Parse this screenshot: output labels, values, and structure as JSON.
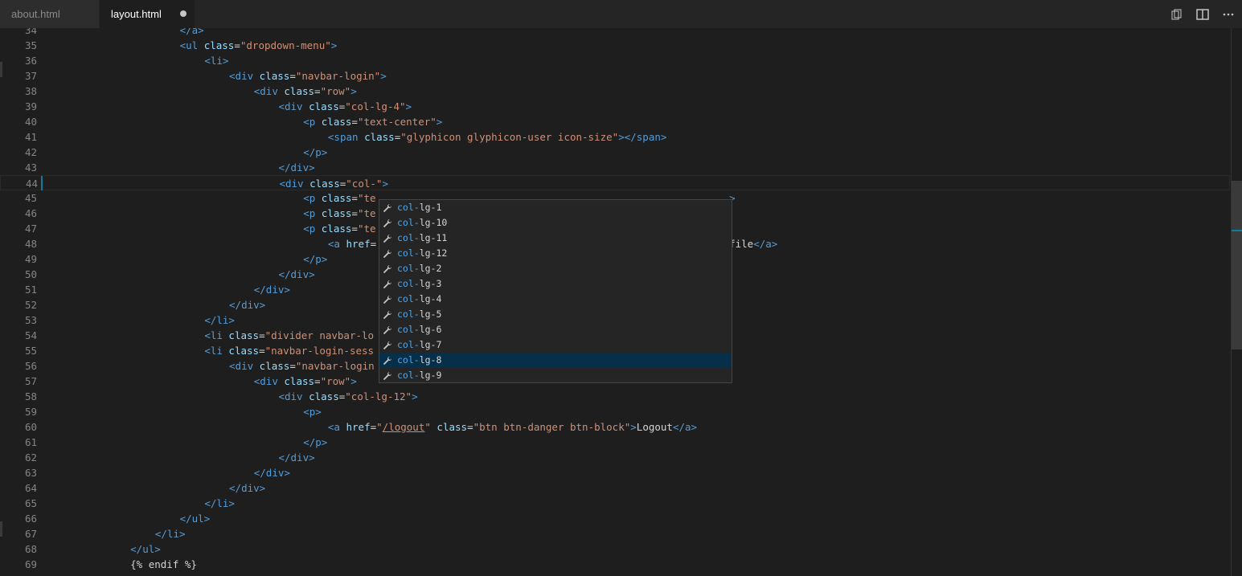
{
  "tabs": [
    {
      "label": "about.html",
      "active": false,
      "dirty": false
    },
    {
      "label": "layout.html",
      "active": true,
      "dirty": true
    }
  ],
  "actions": [
    {
      "icon": "copy-icon"
    },
    {
      "icon": "split-editor-icon"
    },
    {
      "icon": "more-icon"
    }
  ],
  "editor": {
    "current_line": 44,
    "lines": [
      {
        "n": "34",
        "i": 5,
        "segs": [
          [
            "</a>",
            "t"
          ]
        ]
      },
      {
        "n": "35",
        "i": 5,
        "segs": [
          [
            "<ul",
            "t"
          ],
          [
            " ",
            "x"
          ],
          [
            "class",
            "a"
          ],
          [
            "=",
            "x"
          ],
          [
            "\"dropdown-menu\"",
            "s"
          ],
          [
            ">",
            "t"
          ]
        ]
      },
      {
        "n": "36",
        "i": 6,
        "segs": [
          [
            "<li>",
            "t"
          ]
        ]
      },
      {
        "n": "37",
        "i": 7,
        "segs": [
          [
            "<div",
            "t"
          ],
          [
            " ",
            "x"
          ],
          [
            "class",
            "a"
          ],
          [
            "=",
            "x"
          ],
          [
            "\"navbar-login\"",
            "s"
          ],
          [
            ">",
            "t"
          ]
        ]
      },
      {
        "n": "38",
        "i": 8,
        "segs": [
          [
            "<div",
            "t"
          ],
          [
            " ",
            "x"
          ],
          [
            "class",
            "a"
          ],
          [
            "=",
            "x"
          ],
          [
            "\"row\"",
            "s"
          ],
          [
            ">",
            "t"
          ]
        ]
      },
      {
        "n": "39",
        "i": 9,
        "segs": [
          [
            "<div",
            "t"
          ],
          [
            " ",
            "x"
          ],
          [
            "class",
            "a"
          ],
          [
            "=",
            "x"
          ],
          [
            "\"col-lg-4\"",
            "s"
          ],
          [
            ">",
            "t"
          ]
        ]
      },
      {
        "n": "40",
        "i": 10,
        "segs": [
          [
            "<p",
            "t"
          ],
          [
            " ",
            "x"
          ],
          [
            "class",
            "a"
          ],
          [
            "=",
            "x"
          ],
          [
            "\"text-center\"",
            "s"
          ],
          [
            ">",
            "t"
          ]
        ]
      },
      {
        "n": "41",
        "i": 11,
        "segs": [
          [
            "<span",
            "t"
          ],
          [
            " ",
            "x"
          ],
          [
            "class",
            "a"
          ],
          [
            "=",
            "x"
          ],
          [
            "\"glyphicon glyphicon-user icon-size\"",
            "s"
          ],
          [
            "></span>",
            "t"
          ]
        ]
      },
      {
        "n": "42",
        "i": 10,
        "segs": [
          [
            "</p>",
            "t"
          ]
        ]
      },
      {
        "n": "43",
        "i": 9,
        "segs": [
          [
            "</div>",
            "t"
          ]
        ]
      },
      {
        "n": "44",
        "i": 9,
        "segs": [
          [
            "<div",
            "t"
          ],
          [
            " ",
            "x"
          ],
          [
            "class",
            "a"
          ],
          [
            "=",
            "x"
          ],
          [
            "\"col-\"",
            "s"
          ],
          [
            ">",
            "t"
          ]
        ]
      },
      {
        "n": "45",
        "i": 10,
        "segs": [
          [
            "<p",
            "t"
          ],
          [
            " ",
            "x"
          ],
          [
            "class",
            "a"
          ],
          [
            "=",
            "x"
          ],
          [
            "\"te",
            "s"
          ]
        ],
        "tail": {
          "col": 109,
          "segs": [
            [
              ">",
              "t"
            ]
          ]
        }
      },
      {
        "n": "46",
        "i": 10,
        "segs": [
          [
            "<p",
            "t"
          ],
          [
            " ",
            "x"
          ],
          [
            "class",
            "a"
          ],
          [
            "=",
            "x"
          ],
          [
            "\"te",
            "s"
          ]
        ]
      },
      {
        "n": "47",
        "i": 10,
        "segs": [
          [
            "<p",
            "t"
          ],
          [
            " ",
            "x"
          ],
          [
            "class",
            "a"
          ],
          [
            "=",
            "x"
          ],
          [
            "\"te",
            "s"
          ]
        ]
      },
      {
        "n": "48",
        "i": 11,
        "segs": [
          [
            "<a",
            "t"
          ],
          [
            " ",
            "x"
          ],
          [
            "href",
            "a"
          ],
          [
            "=",
            "x"
          ]
        ],
        "tail": {
          "col": 109,
          "segs": [
            [
              "file",
              "x"
            ],
            [
              "</a>",
              "t"
            ]
          ]
        }
      },
      {
        "n": "49",
        "i": 10,
        "segs": [
          [
            "</p>",
            "t"
          ]
        ]
      },
      {
        "n": "50",
        "i": 9,
        "segs": [
          [
            "</div>",
            "t"
          ]
        ]
      },
      {
        "n": "51",
        "i": 8,
        "segs": [
          [
            "</div>",
            "t"
          ]
        ]
      },
      {
        "n": "52",
        "i": 7,
        "segs": [
          [
            "</div>",
            "t"
          ]
        ]
      },
      {
        "n": "53",
        "i": 6,
        "segs": [
          [
            "</li>",
            "t"
          ]
        ]
      },
      {
        "n": "54",
        "i": 6,
        "segs": [
          [
            "<li",
            "t"
          ],
          [
            " ",
            "x"
          ],
          [
            "class",
            "a"
          ],
          [
            "=",
            "x"
          ],
          [
            "\"divider navbar-lo",
            "s"
          ]
        ]
      },
      {
        "n": "55",
        "i": 6,
        "segs": [
          [
            "<li",
            "t"
          ],
          [
            " ",
            "x"
          ],
          [
            "class",
            "a"
          ],
          [
            "=",
            "x"
          ],
          [
            "\"navbar-login-sess",
            "s"
          ]
        ]
      },
      {
        "n": "56",
        "i": 7,
        "segs": [
          [
            "<div",
            "t"
          ],
          [
            " ",
            "x"
          ],
          [
            "class",
            "a"
          ],
          [
            "=",
            "x"
          ],
          [
            "\"navbar-login",
            "s"
          ]
        ]
      },
      {
        "n": "57",
        "i": 8,
        "segs": [
          [
            "<div",
            "t"
          ],
          [
            " ",
            "x"
          ],
          [
            "class",
            "a"
          ],
          [
            "=",
            "x"
          ],
          [
            "\"row\"",
            "s"
          ],
          [
            ">",
            "t"
          ]
        ]
      },
      {
        "n": "58",
        "i": 9,
        "segs": [
          [
            "<div",
            "t"
          ],
          [
            " ",
            "x"
          ],
          [
            "class",
            "a"
          ],
          [
            "=",
            "x"
          ],
          [
            "\"col-lg-12\"",
            "s"
          ],
          [
            ">",
            "t"
          ]
        ]
      },
      {
        "n": "59",
        "i": 10,
        "segs": [
          [
            "<p>",
            "t"
          ]
        ]
      },
      {
        "n": "60",
        "i": 11,
        "segs": [
          [
            "<a",
            "t"
          ],
          [
            " ",
            "x"
          ],
          [
            "href",
            "a"
          ],
          [
            "=",
            "x"
          ],
          [
            "\"",
            "s"
          ],
          [
            "/logout",
            "su"
          ],
          [
            "\"",
            "s"
          ],
          [
            " ",
            "x"
          ],
          [
            "class",
            "a"
          ],
          [
            "=",
            "x"
          ],
          [
            "\"btn btn-danger btn-block\"",
            "s"
          ],
          [
            ">",
            "t"
          ],
          [
            "Logout",
            "x"
          ],
          [
            "</a>",
            "t"
          ]
        ]
      },
      {
        "n": "61",
        "i": 10,
        "segs": [
          [
            "</p>",
            "t"
          ]
        ]
      },
      {
        "n": "62",
        "i": 9,
        "segs": [
          [
            "</div>",
            "t"
          ]
        ]
      },
      {
        "n": "63",
        "i": 8,
        "segs": [
          [
            "</div>",
            "t"
          ]
        ]
      },
      {
        "n": "64",
        "i": 7,
        "segs": [
          [
            "</div>",
            "t"
          ]
        ]
      },
      {
        "n": "65",
        "i": 6,
        "segs": [
          [
            "</li>",
            "t"
          ]
        ]
      },
      {
        "n": "66",
        "i": 5,
        "segs": [
          [
            "</ul>",
            "t"
          ]
        ]
      },
      {
        "n": "67",
        "i": 4,
        "segs": [
          [
            "</li>",
            "t"
          ]
        ]
      },
      {
        "n": "68",
        "i": 3,
        "segs": [
          [
            "</ul>",
            "t"
          ]
        ]
      },
      {
        "n": "69",
        "i": 3,
        "segs": [
          [
            "{% endif %}",
            "x"
          ]
        ]
      }
    ]
  },
  "suggest": {
    "prefix": "col-",
    "selected": 10,
    "items": [
      "col-lg-1",
      "col-lg-10",
      "col-lg-11",
      "col-lg-12",
      "col-lg-2",
      "col-lg-3",
      "col-lg-4",
      "col-lg-5",
      "col-lg-6",
      "col-lg-7",
      "col-lg-8",
      "col-lg-9"
    ]
  }
}
